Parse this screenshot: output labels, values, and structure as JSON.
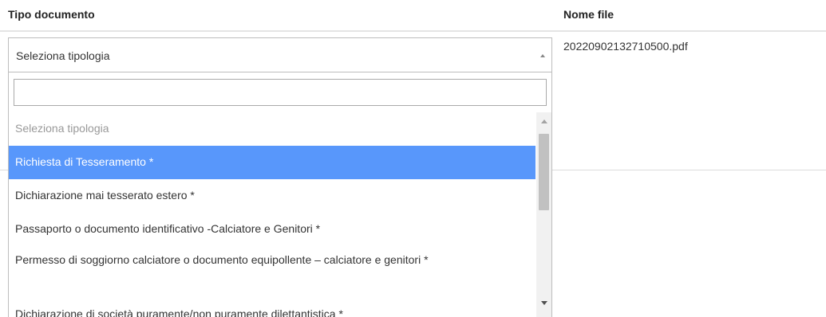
{
  "table": {
    "headers": {
      "tipo_documento": "Tipo documento",
      "nome_file": "Nome file"
    },
    "row": {
      "filename": "20220902132710500.pdf"
    }
  },
  "select": {
    "selected": "Seleziona tipologia",
    "search_value": "",
    "options": [
      "Seleziona tipologia",
      "Richiesta di Tesseramento *",
      "Dichiarazione mai tesserato estero *",
      "Passaporto o documento identificativo -Calciatore e Genitori *",
      "Permesso di soggiorno calciatore o documento equipollente – calciatore e genitori *",
      "Dichiarazione di società puramente/non puramente dilettantistica *"
    ],
    "highlighted_index": 1
  },
  "colors": {
    "highlight": "#5897fb",
    "placeholder_text": "#999999"
  }
}
